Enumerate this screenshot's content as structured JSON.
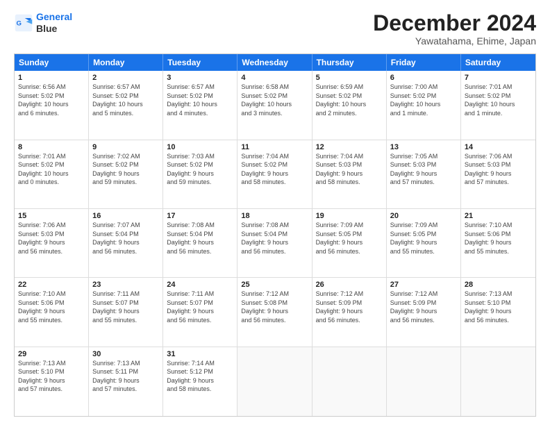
{
  "logo": {
    "line1": "General",
    "line2": "Blue"
  },
  "title": "December 2024",
  "subtitle": "Yawatahama, Ehime, Japan",
  "days_of_week": [
    "Sunday",
    "Monday",
    "Tuesday",
    "Wednesday",
    "Thursday",
    "Friday",
    "Saturday"
  ],
  "weeks": [
    [
      {
        "day": "1",
        "info": "Sunrise: 6:56 AM\nSunset: 5:02 PM\nDaylight: 10 hours\nand 6 minutes."
      },
      {
        "day": "2",
        "info": "Sunrise: 6:57 AM\nSunset: 5:02 PM\nDaylight: 10 hours\nand 5 minutes."
      },
      {
        "day": "3",
        "info": "Sunrise: 6:57 AM\nSunset: 5:02 PM\nDaylight: 10 hours\nand 4 minutes."
      },
      {
        "day": "4",
        "info": "Sunrise: 6:58 AM\nSunset: 5:02 PM\nDaylight: 10 hours\nand 3 minutes."
      },
      {
        "day": "5",
        "info": "Sunrise: 6:59 AM\nSunset: 5:02 PM\nDaylight: 10 hours\nand 2 minutes."
      },
      {
        "day": "6",
        "info": "Sunrise: 7:00 AM\nSunset: 5:02 PM\nDaylight: 10 hours\nand 1 minute."
      },
      {
        "day": "7",
        "info": "Sunrise: 7:01 AM\nSunset: 5:02 PM\nDaylight: 10 hours\nand 1 minute."
      }
    ],
    [
      {
        "day": "8",
        "info": "Sunrise: 7:01 AM\nSunset: 5:02 PM\nDaylight: 10 hours\nand 0 minutes."
      },
      {
        "day": "9",
        "info": "Sunrise: 7:02 AM\nSunset: 5:02 PM\nDaylight: 9 hours\nand 59 minutes."
      },
      {
        "day": "10",
        "info": "Sunrise: 7:03 AM\nSunset: 5:02 PM\nDaylight: 9 hours\nand 59 minutes."
      },
      {
        "day": "11",
        "info": "Sunrise: 7:04 AM\nSunset: 5:02 PM\nDaylight: 9 hours\nand 58 minutes."
      },
      {
        "day": "12",
        "info": "Sunrise: 7:04 AM\nSunset: 5:03 PM\nDaylight: 9 hours\nand 58 minutes."
      },
      {
        "day": "13",
        "info": "Sunrise: 7:05 AM\nSunset: 5:03 PM\nDaylight: 9 hours\nand 57 minutes."
      },
      {
        "day": "14",
        "info": "Sunrise: 7:06 AM\nSunset: 5:03 PM\nDaylight: 9 hours\nand 57 minutes."
      }
    ],
    [
      {
        "day": "15",
        "info": "Sunrise: 7:06 AM\nSunset: 5:03 PM\nDaylight: 9 hours\nand 56 minutes."
      },
      {
        "day": "16",
        "info": "Sunrise: 7:07 AM\nSunset: 5:04 PM\nDaylight: 9 hours\nand 56 minutes."
      },
      {
        "day": "17",
        "info": "Sunrise: 7:08 AM\nSunset: 5:04 PM\nDaylight: 9 hours\nand 56 minutes."
      },
      {
        "day": "18",
        "info": "Sunrise: 7:08 AM\nSunset: 5:04 PM\nDaylight: 9 hours\nand 56 minutes."
      },
      {
        "day": "19",
        "info": "Sunrise: 7:09 AM\nSunset: 5:05 PM\nDaylight: 9 hours\nand 56 minutes."
      },
      {
        "day": "20",
        "info": "Sunrise: 7:09 AM\nSunset: 5:05 PM\nDaylight: 9 hours\nand 55 minutes."
      },
      {
        "day": "21",
        "info": "Sunrise: 7:10 AM\nSunset: 5:06 PM\nDaylight: 9 hours\nand 55 minutes."
      }
    ],
    [
      {
        "day": "22",
        "info": "Sunrise: 7:10 AM\nSunset: 5:06 PM\nDaylight: 9 hours\nand 55 minutes."
      },
      {
        "day": "23",
        "info": "Sunrise: 7:11 AM\nSunset: 5:07 PM\nDaylight: 9 hours\nand 55 minutes."
      },
      {
        "day": "24",
        "info": "Sunrise: 7:11 AM\nSunset: 5:07 PM\nDaylight: 9 hours\nand 56 minutes."
      },
      {
        "day": "25",
        "info": "Sunrise: 7:12 AM\nSunset: 5:08 PM\nDaylight: 9 hours\nand 56 minutes."
      },
      {
        "day": "26",
        "info": "Sunrise: 7:12 AM\nSunset: 5:09 PM\nDaylight: 9 hours\nand 56 minutes."
      },
      {
        "day": "27",
        "info": "Sunrise: 7:12 AM\nSunset: 5:09 PM\nDaylight: 9 hours\nand 56 minutes."
      },
      {
        "day": "28",
        "info": "Sunrise: 7:13 AM\nSunset: 5:10 PM\nDaylight: 9 hours\nand 56 minutes."
      }
    ],
    [
      {
        "day": "29",
        "info": "Sunrise: 7:13 AM\nSunset: 5:10 PM\nDaylight: 9 hours\nand 57 minutes."
      },
      {
        "day": "30",
        "info": "Sunrise: 7:13 AM\nSunset: 5:11 PM\nDaylight: 9 hours\nand 57 minutes."
      },
      {
        "day": "31",
        "info": "Sunrise: 7:14 AM\nSunset: 5:12 PM\nDaylight: 9 hours\nand 58 minutes."
      },
      {
        "day": "",
        "info": ""
      },
      {
        "day": "",
        "info": ""
      },
      {
        "day": "",
        "info": ""
      },
      {
        "day": "",
        "info": ""
      }
    ]
  ]
}
